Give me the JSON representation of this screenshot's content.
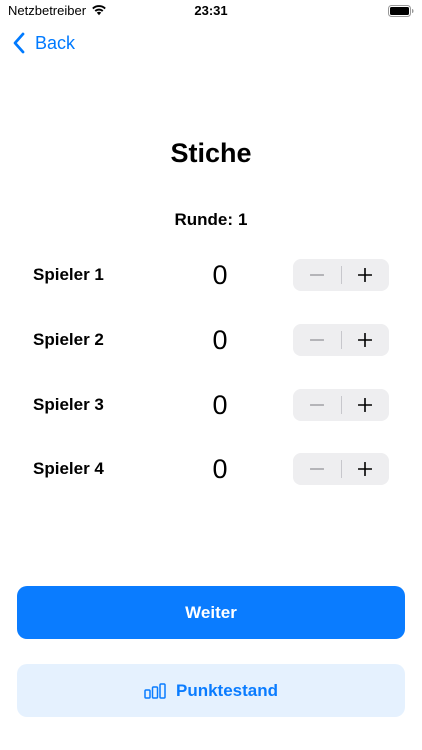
{
  "status_bar": {
    "carrier": "Netzbetreiber",
    "time": "23:31"
  },
  "nav": {
    "back_label": "Back"
  },
  "page": {
    "title": "Stiche",
    "round_label": "Runde:",
    "round_number": "1"
  },
  "players": [
    {
      "name": "Spieler 1",
      "count": "0"
    },
    {
      "name": "Spieler 2",
      "count": "0"
    },
    {
      "name": "Spieler 3",
      "count": "0"
    },
    {
      "name": "Spieler 4",
      "count": "0"
    }
  ],
  "actions": {
    "next_label": "Weiter",
    "scores_label": "Punktestand"
  },
  "colors": {
    "accent": "#0a7cff",
    "secondary_bg": "#e5f1fe",
    "stepper_bg": "#eeeef0"
  },
  "icons": {
    "wifi": "wifi-icon",
    "battery": "battery-icon",
    "back": "chevron-left-icon",
    "minus": "minus-icon",
    "plus": "plus-icon",
    "scores": "bar-chart-icon"
  }
}
